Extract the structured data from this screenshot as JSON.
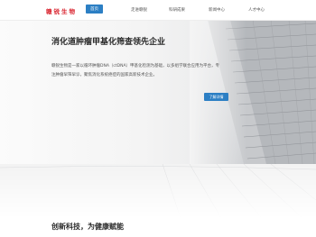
{
  "brand": {
    "name": "赣锐生物",
    "color": "#d9232e"
  },
  "nav": {
    "items": [
      {
        "label": "首页",
        "active": true
      },
      {
        "label": "走进赣锐"
      },
      {
        "label": "科研成果"
      },
      {
        "label": "新闻中心"
      },
      {
        "label": "人才中心"
      }
    ],
    "accent": "#2c7fc4"
  },
  "hero": {
    "headline": "消化道肿瘤甲基化筛查领先企业",
    "description": "赣锐生物是一家以循环肿瘤DNA（ctDNA）甲基化检测为基础，以多组学联合应用为平台，专注肿瘤早筛早诊，聚焦消化系统癌症的国家高新技术企业。",
    "button_label": "了解详情"
  },
  "section": {
    "title": "创新科技，为健康赋能"
  }
}
